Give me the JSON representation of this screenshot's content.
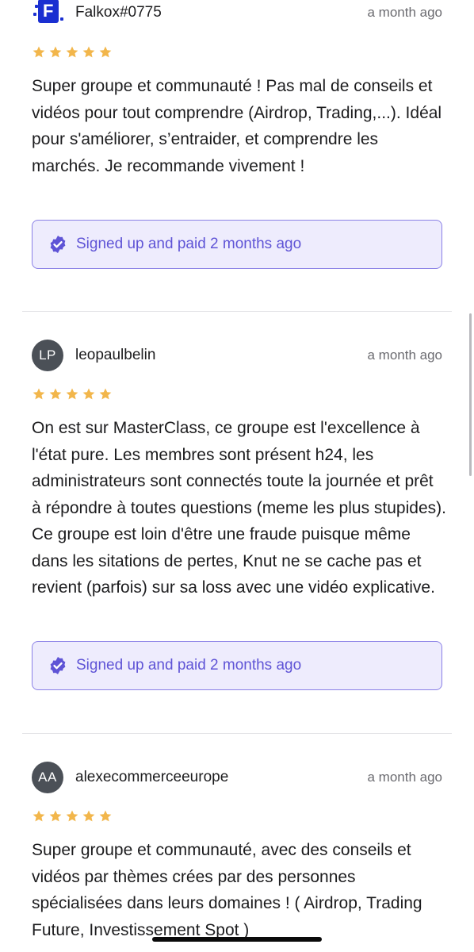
{
  "reviews": [
    {
      "username": "Falkox#0775",
      "avatar_type": "logo",
      "timestamp": "a month ago",
      "rating": 5,
      "body": "Super groupe et communauté ! Pas mal de conseils et vidéos pour tout comprendre (Airdrop, Trading,...). Idéal pour s'améliorer, s’entraider, et comprendre les marchés. Je recommande vivement !",
      "verified": "Signed up and paid 2 months ago"
    },
    {
      "username": "leopaulbelin",
      "avatar_initials": "LP",
      "timestamp": "a month ago",
      "rating": 5,
      "body": "On est sur MasterClass, ce groupe est l'excellence à l'état pure. Les membres sont présent h24, les administrateurs sont connectés toute la journée et prêt à répondre à toutes questions (meme les plus stupides). Ce groupe est loin d'être une fraude puisque même dans les sitations de pertes, Knut ne se cache pas et revient (parfois) sur sa loss avec une vidéo explicative.",
      "verified": "Signed up and paid 2 months ago"
    },
    {
      "username": "alexecommerceeurope",
      "avatar_initials": "AA",
      "timestamp": "a month ago",
      "rating": 5,
      "body": "Super groupe et communauté, avec des conseils et vidéos par thèmes crées par des personnes spécialisées dans leurs domaines ! ( Airdrop, Trading Future, Investissement Spot )"
    }
  ],
  "logo_letter": "F",
  "colors": {
    "star": "#f2b64b",
    "verified_accent": "#5f54d6",
    "verified_bg": "#eeecfd",
    "avatar_bg": "#4b5057"
  }
}
